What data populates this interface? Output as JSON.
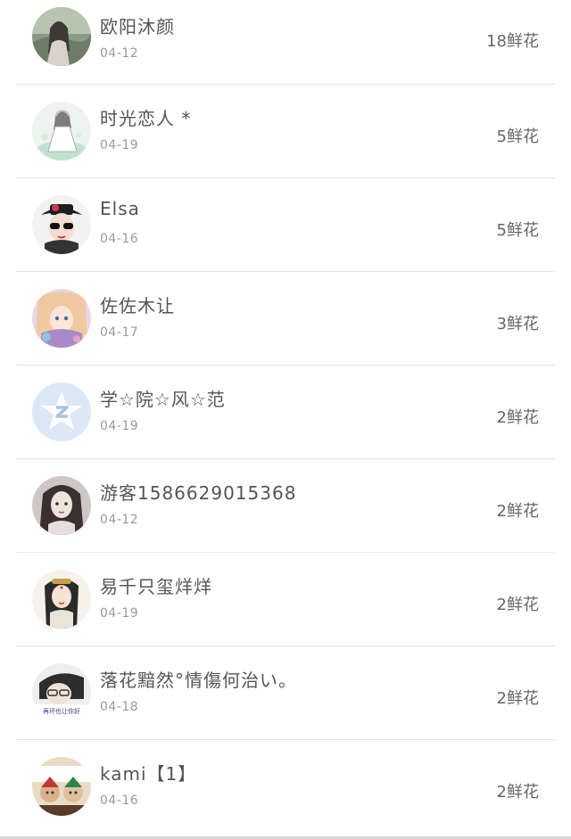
{
  "unit": "鲜花",
  "items": [
    {
      "name": "欧阳沐颜",
      "date": "04-12",
      "count": "18",
      "flowers": "18鲜花",
      "avatar": "avatar-girl-landscape"
    },
    {
      "name": "时光恋人 *",
      "date": "04-19",
      "count": "5",
      "flowers": "5鲜花",
      "avatar": "avatar-illustration-girl"
    },
    {
      "name": "Elsa",
      "date": "04-16",
      "count": "5",
      "flowers": "5鲜花",
      "avatar": "avatar-girl-hat-sunglasses"
    },
    {
      "name": "佐佐木让",
      "date": "04-17",
      "count": "3",
      "flowers": "3鲜花",
      "avatar": "avatar-anime-girl"
    },
    {
      "name": "学☆院☆风☆范",
      "date": "04-19",
      "count": "2",
      "flowers": "2鲜花",
      "avatar": "avatar-default-star"
    },
    {
      "name": "游客1586629015368",
      "date": "04-12",
      "count": "2",
      "flowers": "2鲜花",
      "avatar": "avatar-girl-portrait"
    },
    {
      "name": "易千只玺烊烊",
      "date": "04-19",
      "count": "2",
      "flowers": "2鲜花",
      "avatar": "avatar-costume-girl"
    },
    {
      "name": "落花黯然°情傷何治い。",
      "date": "04-18",
      "count": "2",
      "flowers": "2鲜花",
      "avatar": "avatar-boy-caption",
      "avatar_caption": "再坏也让你好"
    },
    {
      "name": "kami【1】",
      "date": "04-16",
      "count": "2",
      "flowers": "2鲜花",
      "avatar": "avatar-dolls"
    }
  ],
  "colors": {
    "divider": "#e6e6e6",
    "name": "#555555",
    "date": "#9a9a9a",
    "flowers": "#666666",
    "default_avatar_bg": "#dce8f5"
  }
}
